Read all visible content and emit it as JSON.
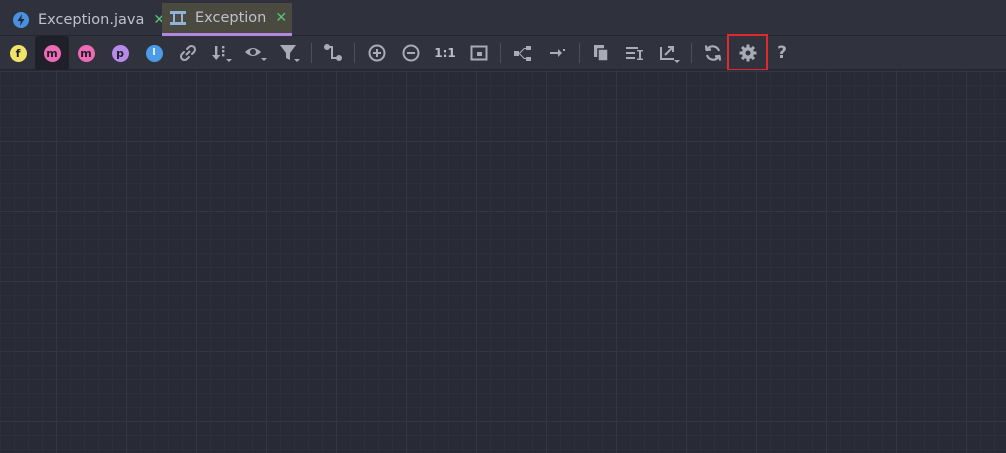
{
  "tabs": [
    {
      "label": "Exception.java",
      "icon": "lightning-icon",
      "close": "✕"
    },
    {
      "label": "Exception",
      "icon": "diagram-icon",
      "close": "✕",
      "active": true
    }
  ],
  "toolbar": {
    "fields_badge": "f",
    "methods_badge": "m",
    "constructors_badge": "m",
    "properties_badge": "p",
    "inner_badge": "I",
    "actual_size_label": "1:1",
    "help_label": "?",
    "selected_button": "settings"
  },
  "colors": {
    "fields": "#f0e26a",
    "methods": "#ec6bb4",
    "properties": "#b58ae8",
    "inner": "#4a9ce8",
    "tab_underline": "#b18ae0",
    "selection_outline": "#e0282d"
  }
}
